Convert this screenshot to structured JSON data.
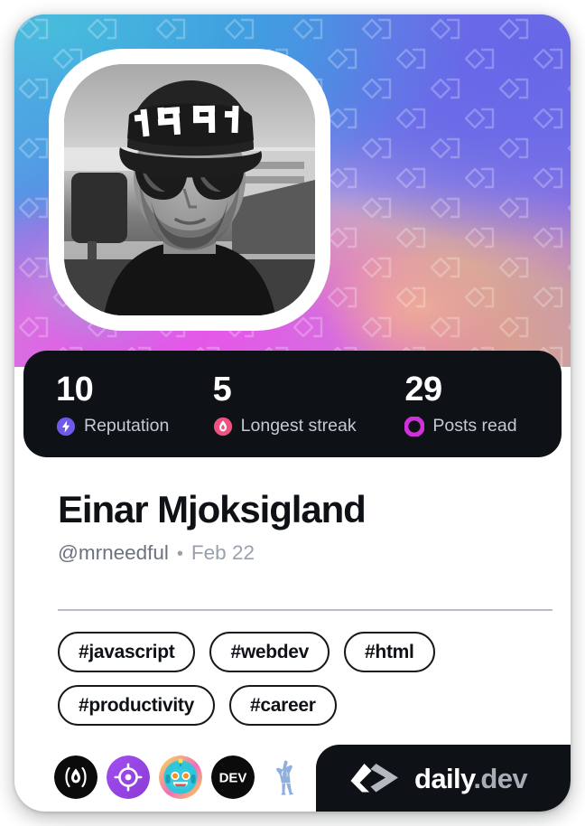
{
  "card": {
    "type": "developer-card"
  },
  "profile": {
    "display_name": "Einar Mjoksigland",
    "handle": "@mrneedful",
    "separator": "•",
    "joined": "Feb 22",
    "avatar_alt": "grayscale selfie of man wearing 1991 cap and sunglasses in a car"
  },
  "stats": [
    {
      "value": "10",
      "label": "Reputation",
      "icon": "reputation-bolt-icon",
      "color": "#6e5ae8"
    },
    {
      "value": "5",
      "label": "Longest streak",
      "icon": "streak-flame-icon",
      "color": "#f0527f"
    },
    {
      "value": "29",
      "label": "Posts read",
      "icon": "posts-read-ring-icon",
      "color": "#cf32d8"
    }
  ],
  "tags": [
    {
      "label": "#javascript"
    },
    {
      "label": "#webdev"
    },
    {
      "label": "#html"
    },
    {
      "label": "#productivity"
    },
    {
      "label": "#career"
    }
  ],
  "badges": [
    {
      "name": "flame-in-parentheses-badge",
      "bg": "#0b0b0b"
    },
    {
      "name": "crosshair-target-badge",
      "bg": "#9c4dea"
    },
    {
      "name": "robot-avatar-badge",
      "bg": "#f5e25a"
    },
    {
      "name": "dev-to-badge",
      "bg": "#0b0b0b",
      "label": "DEV"
    },
    {
      "name": "dancing-figure-badge",
      "bg": "#8fb0dd"
    }
  ],
  "brand": {
    "name": "daily",
    "suffix": ".dev",
    "logo": "daily-dev-chevron-logo"
  },
  "theme": {
    "card_bg": "#ffffff",
    "dark_panel": "#0e1217",
    "text_primary": "#0e1217",
    "text_muted": "#6b7280",
    "divider": "#b9bec6"
  }
}
